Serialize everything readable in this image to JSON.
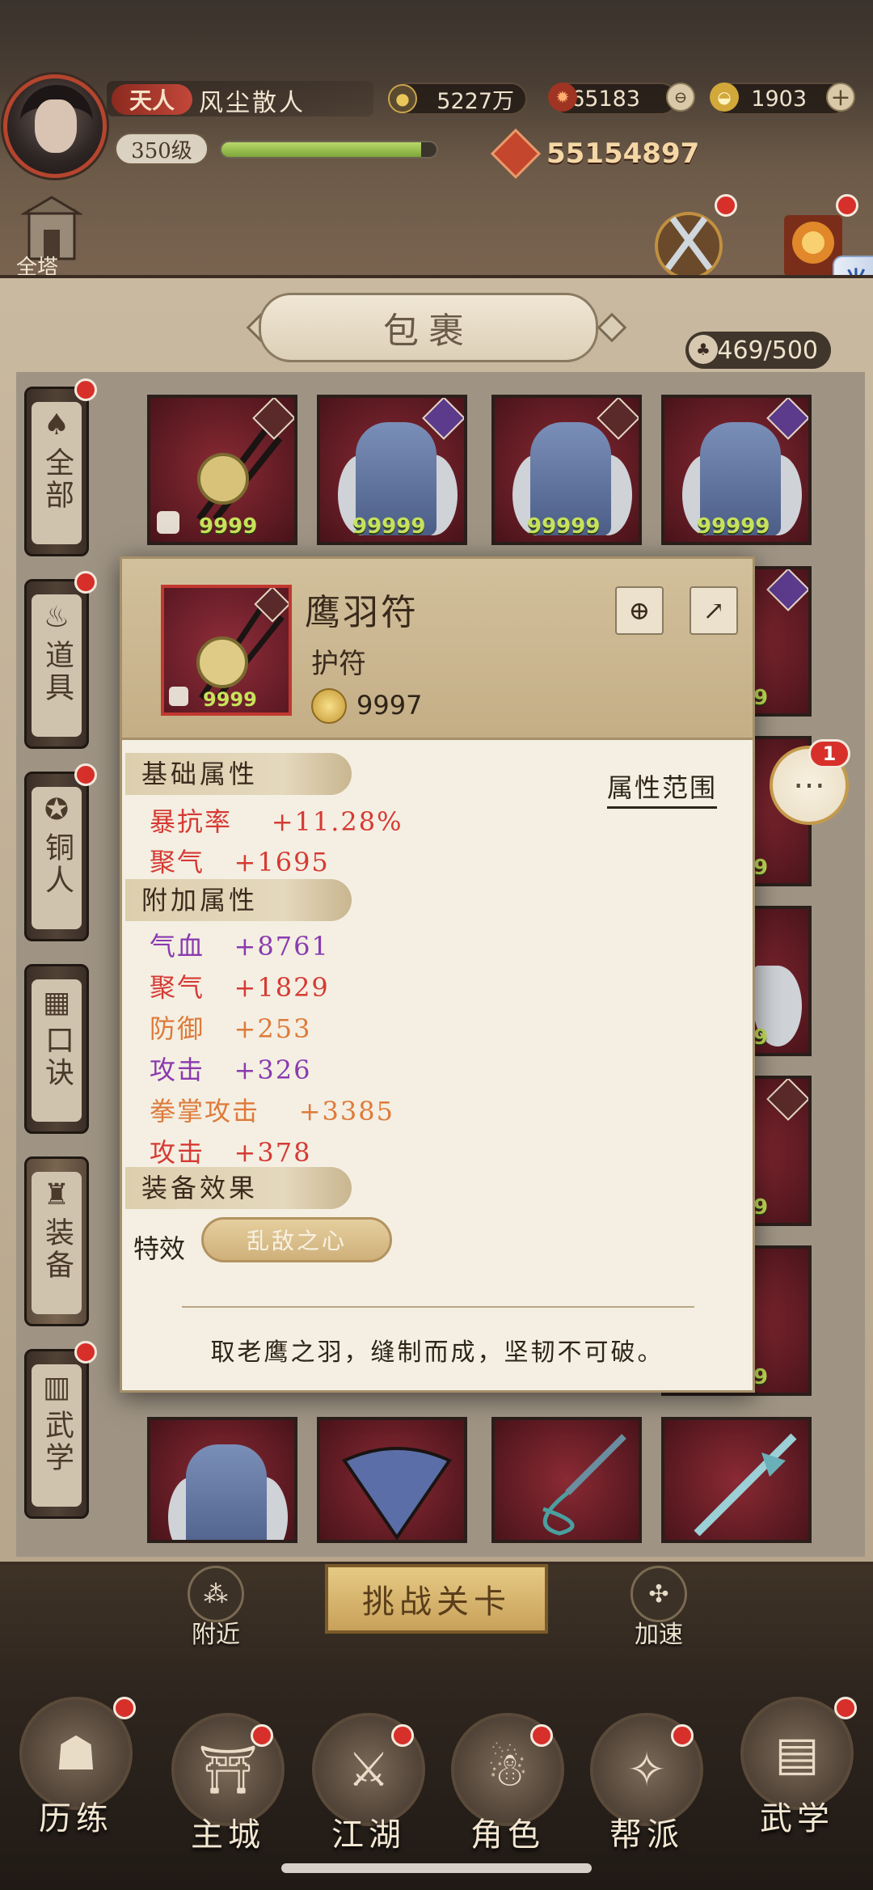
{
  "hud": {
    "rank": "天人",
    "player_name": "风尘散人",
    "level": "350级",
    "xp_fraction": 0.93,
    "power": "55154897",
    "resources": [
      {
        "icon": "coin-icon",
        "value": "5227万"
      },
      {
        "icon": "ruby-icon",
        "value": "65183"
      },
      {
        "icon": "gold-ingot-icon",
        "value": "1903"
      }
    ],
    "tower_label": "全塔"
  },
  "helper_tab": "光环助手",
  "bag": {
    "title": "包裹",
    "capacity": "469/500",
    "categories": [
      {
        "label": "全部",
        "icon": "fan-icon"
      },
      {
        "label": "道具",
        "icon": "pouch-icon"
      },
      {
        "label": "铜人",
        "icon": "bronze-figure-icon"
      },
      {
        "label": "口诀",
        "icon": "scroll-icon"
      },
      {
        "label": "装备",
        "icon": "armor-icon"
      },
      {
        "label": "武学",
        "icon": "book-icon"
      }
    ],
    "top_row_qty": [
      "9999",
      "99999",
      "99999",
      "99999"
    ],
    "side_qty": [
      "9",
      "9",
      "9",
      "9",
      "9",
      "9"
    ]
  },
  "detail": {
    "name": "鹰羽符",
    "type": "护符",
    "icon_qty": "9999",
    "price": "9997",
    "range_link": "属性范围",
    "base_title": "基础属性",
    "base_attrs": [
      {
        "label": "暴抗率",
        "value": "+11.28%"
      },
      {
        "label": "聚气",
        "value": "+1695"
      }
    ],
    "extra_title": "附加属性",
    "extra_attrs": [
      {
        "label": "气血",
        "value": "+8761"
      },
      {
        "label": "聚气",
        "value": "+1829"
      },
      {
        "label": "防御",
        "value": "+253"
      },
      {
        "label": "攻击",
        "value": "+326"
      },
      {
        "label": "拳掌攻击",
        "value": "+3385"
      },
      {
        "label": "攻击",
        "value": "+378"
      }
    ],
    "effect_title": "装备效果",
    "effect_label": "特效",
    "effect_name": "乱敌之心",
    "flavor": "取老鹰之羽，缝制而成，坚韧不可破。"
  },
  "chat_badge": "1",
  "bottom": {
    "challenge": "挑战关卡",
    "left_action": "附近",
    "right_action": "加速",
    "nav": [
      "历练",
      "主城",
      "江湖",
      "角色",
      "帮派",
      "武学"
    ]
  }
}
